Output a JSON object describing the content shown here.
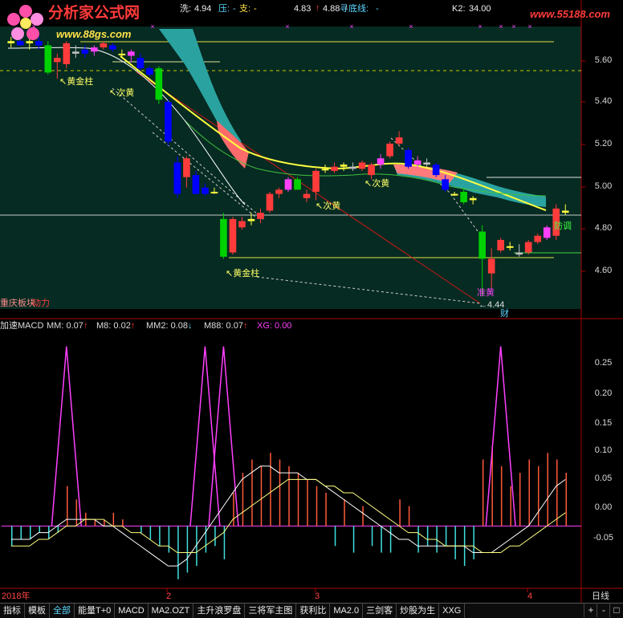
{
  "header": {
    "logo_text": "分析家公式网",
    "logo_url": "www.88gs.com",
    "wash_label": "洗:",
    "wash_value": "4.94",
    "pressure_label": "压:",
    "pressure_value": "-",
    "support_label": "支:",
    "support_value": "-",
    "v1": "4.83",
    "v2": "4.88",
    "bottom_label": "寻底线:",
    "bottom_value": "-",
    "k2_label": "K2:",
    "k2_value": "34.00",
    "site2": "www.55188.com"
  },
  "price_axis": {
    "ticks": [
      "5.60",
      "5.40",
      "5.20",
      "5.00",
      "4.80",
      "4.60"
    ]
  },
  "price_labels": {
    "gold1": "黄金柱",
    "ci1": "次黄",
    "ci2": "次黄",
    "ci3": "次黄",
    "gold2": "黄金柱",
    "jiahuang": "准黄",
    "fangtiao": "防调",
    "low": "4.44",
    "cai": "财",
    "stock": "重庆板块",
    "dongli": "动力"
  },
  "indicator": {
    "name": "加速MACD",
    "mm_label": "MM:",
    "mm_value": "0.07",
    "m8_label": "M8:",
    "m8_value": "0.02",
    "mm2_label": "MM2:",
    "mm2_value": "0.08",
    "m88_label": "M88:",
    "m88_value": "0.07",
    "xg_label": "XG:",
    "xg_value": "0.00",
    "axis_ticks": [
      "0.25",
      "0.20",
      "0.15",
      "0.10",
      "0.05",
      "0.00",
      "-0.05"
    ]
  },
  "time_axis": {
    "labels": [
      "2018年",
      "2",
      "3",
      "4"
    ],
    "period": "日线"
  },
  "tabs": [
    "指标",
    "模板",
    "全部",
    "能量T+0",
    "MACD",
    "MA2.OZT",
    "主升浪罗盘",
    "三将军主图",
    "获利比",
    "MA2.0",
    "三剑客",
    "炒股为生",
    "XXG"
  ],
  "active_tab": "全部",
  "corner_buttons": [
    "+",
    "-",
    "□"
  ],
  "colors": {
    "up": "#ff3b3b",
    "down": "#0000ff",
    "green": "#00d100",
    "magenta": "#ff40ff",
    "cyan": "#00d0d0",
    "yellow": "#ffff40",
    "background": "#000000",
    "panel": "#062b22"
  },
  "chart_data": {
    "type": "candlestick",
    "ylim": [
      4.4,
      5.75
    ],
    "candles": [
      {
        "o": 5.67,
        "h": 5.7,
        "l": 5.65,
        "c": 5.68
      },
      {
        "o": 5.68,
        "h": 5.7,
        "l": 5.66,
        "c": 5.66
      },
      {
        "o": 5.67,
        "h": 5.7,
        "l": 5.64,
        "c": 5.68
      },
      {
        "o": 5.68,
        "h": 5.7,
        "l": 5.64,
        "c": 5.66
      },
      {
        "o": 5.66,
        "h": 5.68,
        "l": 5.52,
        "c": 5.53
      },
      {
        "o": 5.58,
        "h": 5.62,
        "l": 5.5,
        "c": 5.6
      },
      {
        "o": 5.57,
        "h": 5.68,
        "l": 5.55,
        "c": 5.67
      },
      {
        "o": 5.63,
        "h": 5.66,
        "l": 5.6,
        "c": 5.62
      },
      {
        "o": 5.64,
        "h": 5.66,
        "l": 5.6,
        "c": 5.62
      },
      {
        "o": 5.63,
        "h": 5.66,
        "l": 5.61,
        "c": 5.65
      },
      {
        "o": 5.65,
        "h": 5.68,
        "l": 5.64,
        "c": 5.67
      },
      {
        "o": 5.66,
        "h": 5.67,
        "l": 5.63,
        "c": 5.64
      },
      {
        "o": 5.62,
        "h": 5.64,
        "l": 5.6,
        "c": 5.62
      },
      {
        "o": 5.61,
        "h": 5.64,
        "l": 5.58,
        "c": 5.63
      },
      {
        "o": 5.6,
        "h": 5.62,
        "l": 5.54,
        "c": 5.55
      },
      {
        "o": 5.55,
        "h": 5.56,
        "l": 5.51,
        "c": 5.52
      },
      {
        "o": 5.55,
        "h": 5.56,
        "l": 5.38,
        "c": 5.4
      },
      {
        "o": 5.39,
        "h": 5.4,
        "l": 5.18,
        "c": 5.2
      },
      {
        "o": 5.1,
        "h": 5.13,
        "l": 4.93,
        "c": 4.95
      },
      {
        "o": 5.03,
        "h": 5.13,
        "l": 4.98,
        "c": 5.12
      },
      {
        "o": 5.04,
        "h": 5.06,
        "l": 4.95,
        "c": 4.95
      },
      {
        "o": 4.98,
        "h": 5.0,
        "l": 4.94,
        "c": 4.95
      },
      {
        "o": 4.96,
        "h": 4.98,
        "l": 4.95,
        "c": 4.96
      },
      {
        "o": 4.83,
        "h": 4.86,
        "l": 4.64,
        "c": 4.65
      },
      {
        "o": 4.67,
        "h": 4.84,
        "l": 4.66,
        "c": 4.83
      },
      {
        "o": 4.79,
        "h": 4.84,
        "l": 4.78,
        "c": 4.82
      },
      {
        "o": 4.82,
        "h": 4.86,
        "l": 4.8,
        "c": 4.83
      },
      {
        "o": 4.83,
        "h": 4.88,
        "l": 4.81,
        "c": 4.86
      },
      {
        "o": 4.87,
        "h": 4.96,
        "l": 4.86,
        "c": 4.95
      },
      {
        "o": 4.95,
        "h": 4.98,
        "l": 4.93,
        "c": 4.97
      },
      {
        "o": 4.97,
        "h": 5.03,
        "l": 4.96,
        "c": 5.02
      },
      {
        "o": 5.02,
        "h": 5.03,
        "l": 4.97,
        "c": 4.97
      },
      {
        "o": 4.93,
        "h": 4.97,
        "l": 4.91,
        "c": 4.95
      },
      {
        "o": 4.96,
        "h": 5.07,
        "l": 4.92,
        "c": 5.06
      },
      {
        "o": 5.07,
        "h": 5.09,
        "l": 5.05,
        "c": 5.07
      },
      {
        "o": 5.06,
        "h": 5.1,
        "l": 5.05,
        "c": 5.08
      },
      {
        "o": 5.08,
        "h": 5.1,
        "l": 5.06,
        "c": 5.09
      },
      {
        "o": 5.08,
        "h": 5.1,
        "l": 5.06,
        "c": 5.07
      },
      {
        "o": 5.07,
        "h": 5.11,
        "l": 5.06,
        "c": 5.1
      },
      {
        "o": 5.04,
        "h": 5.1,
        "l": 5.02,
        "c": 5.09
      },
      {
        "o": 5.09,
        "h": 5.14,
        "l": 5.07,
        "c": 5.12
      },
      {
        "o": 5.13,
        "h": 5.2,
        "l": 5.12,
        "c": 5.19
      },
      {
        "o": 5.19,
        "h": 5.25,
        "l": 5.18,
        "c": 5.22
      },
      {
        "o": 5.16,
        "h": 5.17,
        "l": 5.07,
        "c": 5.08
      },
      {
        "o": 5.09,
        "h": 5.13,
        "l": 5.07,
        "c": 5.11
      },
      {
        "o": 5.1,
        "h": 5.12,
        "l": 5.08,
        "c": 5.09
      },
      {
        "o": 5.09,
        "h": 5.1,
        "l": 5.03,
        "c": 5.04
      },
      {
        "o": 5.02,
        "h": 5.04,
        "l": 4.96,
        "c": 4.97
      },
      {
        "o": 4.95,
        "h": 4.96,
        "l": 4.94,
        "c": 4.95
      },
      {
        "o": 4.96,
        "h": 4.98,
        "l": 4.9,
        "c": 4.91
      },
      {
        "o": 4.92,
        "h": 4.94,
        "l": 4.9,
        "c": 4.93
      },
      {
        "o": 4.77,
        "h": 4.8,
        "l": 4.46,
        "c": 4.64
      },
      {
        "o": 4.57,
        "h": 4.69,
        "l": 4.5,
        "c": 4.64
      },
      {
        "o": 4.68,
        "h": 4.74,
        "l": 4.67,
        "c": 4.73
      },
      {
        "o": 4.7,
        "h": 4.72,
        "l": 4.68,
        "c": 4.7
      },
      {
        "o": 4.67,
        "h": 4.71,
        "l": 4.65,
        "c": 4.66
      },
      {
        "o": 4.67,
        "h": 4.73,
        "l": 4.66,
        "c": 4.72
      },
      {
        "o": 4.72,
        "h": 4.76,
        "l": 4.71,
        "c": 4.75
      },
      {
        "o": 4.74,
        "h": 4.8,
        "l": 4.73,
        "c": 4.79
      },
      {
        "o": 4.75,
        "h": 4.9,
        "l": 4.73,
        "c": 4.88
      },
      {
        "o": 4.86,
        "h": 4.9,
        "l": 4.85,
        "c": 4.87
      }
    ],
    "histogram": [
      -0.03,
      -0.02,
      -0.02,
      -0.01,
      -0.02,
      -0.01,
      0.06,
      0.04,
      0.02,
      0.01,
      0.01,
      0.02,
      0.01,
      0.0,
      -0.01,
      -0.02,
      -0.03,
      -0.04,
      -0.08,
      -0.07,
      -0.06,
      -0.04,
      -0.03,
      -0.05,
      0.05,
      0.08,
      0.1,
      0.09,
      0.11,
      0.1,
      0.09,
      0.08,
      0.07,
      0.06,
      0.05,
      -0.03,
      0.04,
      -0.04,
      0.03,
      -0.03,
      -0.04,
      -0.04,
      0.04,
      0.03,
      -0.04,
      -0.03,
      -0.04,
      -0.03,
      -0.05,
      -0.06,
      -0.05,
      0.1,
      0.12,
      0.09,
      0.06,
      0.08,
      0.1,
      0.09,
      0.11,
      0.1,
      0.08
    ],
    "spikes": [
      {
        "index": 6,
        "value": 0.27
      },
      {
        "index": 21,
        "value": 0.27
      },
      {
        "index": 23,
        "value": 0.27
      },
      {
        "index": 53,
        "value": 0.27
      }
    ],
    "line_mm": [
      -0.02,
      -0.02,
      -0.02,
      -0.01,
      -0.01,
      0.0,
      0.01,
      0.01,
      0.01,
      0.01,
      0.0,
      0.0,
      -0.01,
      -0.02,
      -0.03,
      -0.04,
      -0.05,
      -0.06,
      -0.06,
      -0.05,
      -0.03,
      -0.01,
      0.01,
      0.03,
      0.05,
      0.07,
      0.08,
      0.09,
      0.09,
      0.08,
      0.08,
      0.08,
      0.07,
      0.07,
      0.06,
      0.05,
      0.04,
      0.03,
      0.02,
      0.01,
      0.0,
      -0.01,
      -0.02,
      -0.02,
      -0.03,
      -0.03,
      -0.03,
      -0.03,
      -0.03,
      -0.03,
      -0.04,
      -0.04,
      -0.04,
      -0.03,
      -0.02,
      -0.01,
      0.0,
      0.02,
      0.04,
      0.06,
      0.07
    ],
    "line_m8": [
      -0.03,
      -0.03,
      -0.03,
      -0.02,
      -0.02,
      -0.01,
      0.0,
      0.0,
      0.01,
      0.01,
      0.01,
      0.0,
      0.0,
      -0.01,
      -0.01,
      -0.02,
      -0.03,
      -0.03,
      -0.04,
      -0.04,
      -0.04,
      -0.03,
      -0.02,
      -0.01,
      0.01,
      0.02,
      0.03,
      0.04,
      0.05,
      0.06,
      0.07,
      0.07,
      0.07,
      0.07,
      0.06,
      0.06,
      0.05,
      0.05,
      0.04,
      0.03,
      0.02,
      0.01,
      0.0,
      -0.01,
      -0.01,
      -0.02,
      -0.02,
      -0.03,
      -0.03,
      -0.03,
      -0.03,
      -0.04,
      -0.04,
      -0.04,
      -0.03,
      -0.03,
      -0.02,
      -0.01,
      0.0,
      0.01,
      0.02
    ]
  }
}
